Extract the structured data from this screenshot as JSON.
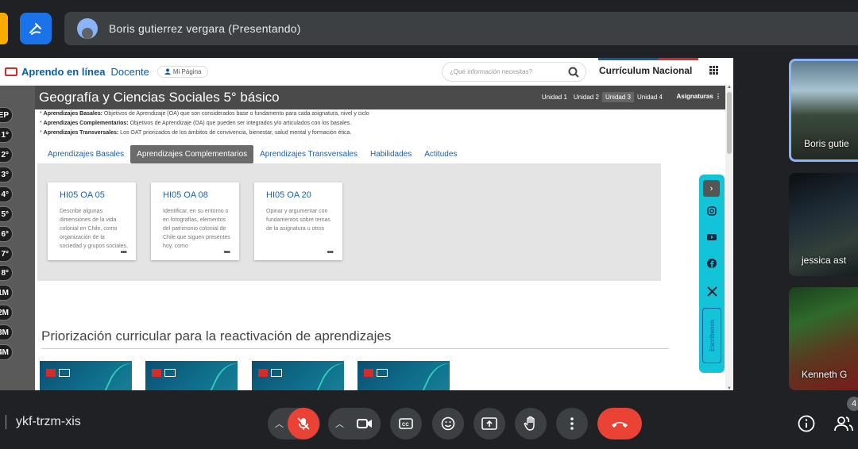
{
  "meet": {
    "presenter": "Boris gutierrez vergara (Presentando)",
    "code": "ykf-trzm-xis",
    "participant_count": "4",
    "tiles": [
      {
        "name": "Boris gutie"
      },
      {
        "name": "jessica ast"
      },
      {
        "name": "Kenneth G"
      }
    ]
  },
  "site": {
    "logo_text": "Aprendo en línea",
    "docente": "Docente",
    "mi_pagina": "Mi Página",
    "search_placeholder": "¿Qué información necesitas?",
    "curriculum": "Currículum Nacional",
    "subject_title": "Geografía y Ciencias Sociales 5° básico",
    "units": [
      "Unidad 1",
      "Unidad 2",
      "Unidad 3",
      "Unidad 4"
    ],
    "active_unit": 2,
    "asignaturas": "Asignaturas",
    "grades": [
      "EP",
      "1°",
      "2°",
      "3°",
      "4°",
      "5°",
      "6°",
      "7°",
      "8°",
      "1M",
      "2M",
      "3M",
      "4M"
    ],
    "defs": [
      {
        "label": "Aprendizajes Basales:",
        "text": " Objetivos de Aprendizaje (OA) que son considerados base o fundamento para cada asignatura, nivel y ciclo"
      },
      {
        "label": "Aprendizajes Complementarios:",
        "text": " Objetivos de Aprendizaje (OA) que pueden ser integrados y/o articulados con los basales."
      },
      {
        "label": "Aprendizajes Transversales:",
        "text": " Los OAT priorizados de los ámbitos de convivencia, bienestar, salud mental y formación ética."
      }
    ],
    "tabs": [
      "Aprendizajes Basales",
      "Aprendizajes Complementarios",
      "Aprendizajes Transversales",
      "Habilidades",
      "Actitudes"
    ],
    "active_tab": 1,
    "cards": [
      {
        "title": "HI05 OA 05",
        "text": "Describir algunas dimensiones de la vida colonial en Chile, como organización de la sociedad y grupos sociales, oficios y"
      },
      {
        "title": "HI05 OA 08",
        "text": "Identificar, en su entorno o en fotografías, elementos del patrimonio colonial de Chile que siguen presentes hoy, como"
      },
      {
        "title": "HI05 OA 20",
        "text": "Opinar y argumentar con fundamentos sobre temas de la asignatura u otros"
      }
    ],
    "card_more": "•••",
    "prior_title": "Priorización curricular para la reactivación de aprendizajes",
    "escribenos": "Escríbenos"
  }
}
